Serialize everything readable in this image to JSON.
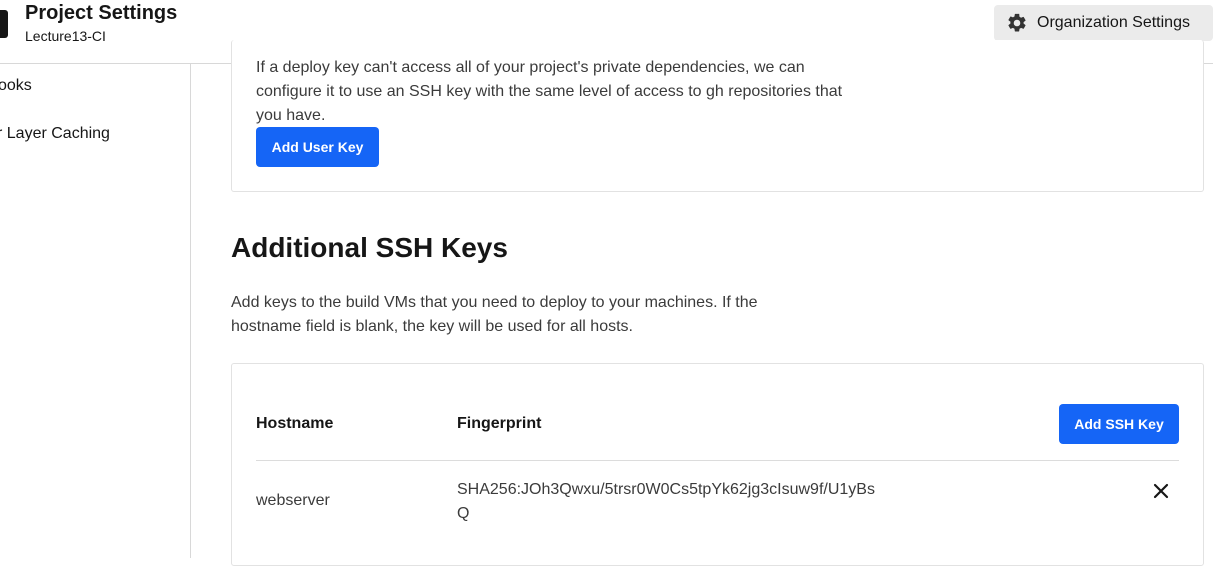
{
  "header": {
    "title": "Project Settings",
    "subtitle": "Lecture13-CI",
    "org_settings_label": "Organization Settings"
  },
  "sidebar": {
    "items": [
      {
        "label": "ooks"
      },
      {
        "label": "r Layer Caching"
      }
    ]
  },
  "user_key_section": {
    "description_lines": [
      "If a deploy key can't access all of your project's private dependencies, we can",
      "configure it to use an SSH key with the same level of access to gh repositories that",
      "you have."
    ],
    "add_button_label": "Add User Key"
  },
  "additional_ssh": {
    "heading": "Additional SSH Keys",
    "description_lines": [
      "Add keys to the build VMs that you need to deploy to your machines. If the",
      "hostname field is blank, the key will be used for all hosts."
    ],
    "table": {
      "columns": [
        "Hostname",
        "Fingerprint"
      ],
      "add_button_label": "Add SSH Key",
      "rows": [
        {
          "hostname": "webserver",
          "fingerprint_lines": [
            "SHA256:JOh3Qwxu/5trsr0W0Cs5tpYk62jg3cIsuw9f/U1yBs",
            "Q"
          ]
        }
      ]
    }
  },
  "colors": {
    "primary": "#1565f6",
    "border": "#e2e2e2",
    "org_button_bg": "#ebebeb"
  },
  "icons": {
    "org_settings": "gear-icon",
    "delete_key": "close-icon"
  }
}
